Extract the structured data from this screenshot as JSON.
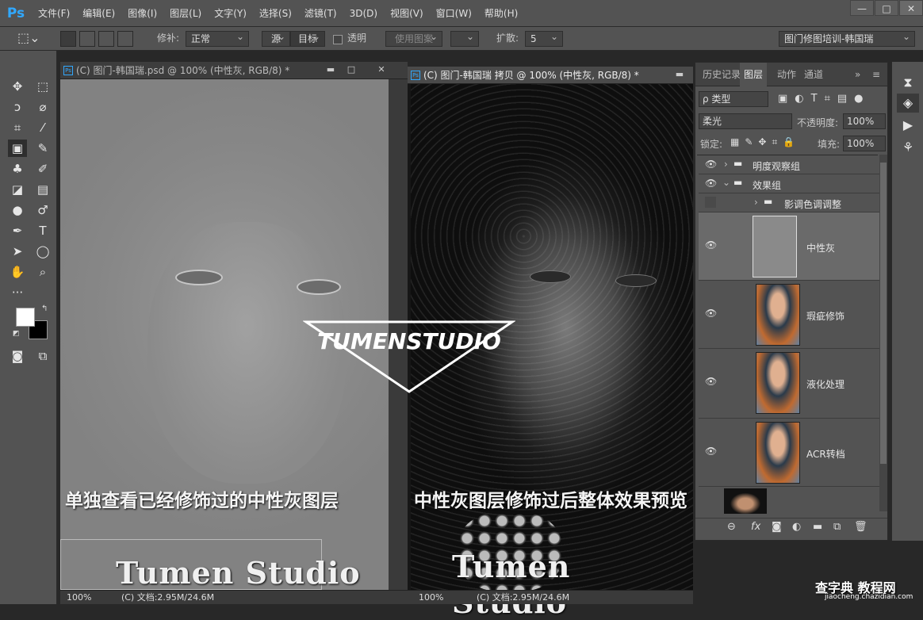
{
  "app": {
    "logo": "Ps"
  },
  "menu": [
    "文件(F)",
    "编辑(E)",
    "图像(I)",
    "图层(L)",
    "文字(Y)",
    "选择(S)",
    "滤镜(T)",
    "3D(D)",
    "视图(V)",
    "窗口(W)",
    "帮助(H)"
  ],
  "window": {
    "minimize": "—",
    "restore": "□",
    "close": "✕"
  },
  "options": {
    "repair_label": "修补:",
    "repair_value": "正常",
    "source": "源",
    "target": "目标",
    "transparent": "透明",
    "use_pattern": "使用图案",
    "diffuse_label": "扩散:",
    "diffuse_value": "5",
    "workspace": "图门修图培训-韩国瑞"
  },
  "documents": [
    {
      "title": "(C) 图门-韩国瑞.psd @ 100% (中性灰, RGB/8) *",
      "zoom": "100%",
      "info": "(C) 文档:2.95M/24.6M",
      "caption": "单独查看已经修饰过的中性灰图层"
    },
    {
      "title": "(C) 图门-韩国瑞 拷贝 @ 100% (中性灰, RGB/8) *",
      "zoom": "100%",
      "info": "(C) 文档:2.95M/24.6M",
      "caption": "中性灰图层修饰过后整体效果预览"
    }
  ],
  "panel": {
    "tabs": [
      "历史记录",
      "图层",
      "动作",
      "通道"
    ],
    "active_tab": "图层",
    "filter_label": "ρ 类型",
    "blend_mode": "柔光",
    "opacity_label": "不透明度:",
    "opacity_value": "100%",
    "lock_label": "锁定:",
    "fill_label": "填充:",
    "fill_value": "100%",
    "layers": [
      {
        "name": "明度观察组",
        "type": "group",
        "visible": true,
        "expanded": false
      },
      {
        "name": "效果组",
        "type": "group",
        "visible": true,
        "expanded": true
      },
      {
        "name": "影调色调调整",
        "type": "group",
        "visible": false,
        "expanded": false
      },
      {
        "name": "中性灰",
        "type": "layer",
        "visible": true,
        "selected": true
      },
      {
        "name": "瑕疵修饰",
        "type": "layer",
        "visible": true
      },
      {
        "name": "液化处理",
        "type": "layer",
        "visible": true
      },
      {
        "name": "ACR转档",
        "type": "layer",
        "visible": true
      }
    ]
  },
  "watermark": {
    "logo_text": "TUMENSTUDIO",
    "brand": "Tumen Studio"
  },
  "site": {
    "name": "查字典 教程网",
    "url": "jiaocheng.chazidian.com"
  },
  "colors": {
    "accent": "#31a8ff",
    "selection_border": "#e03a3a",
    "panel": "#535353"
  }
}
